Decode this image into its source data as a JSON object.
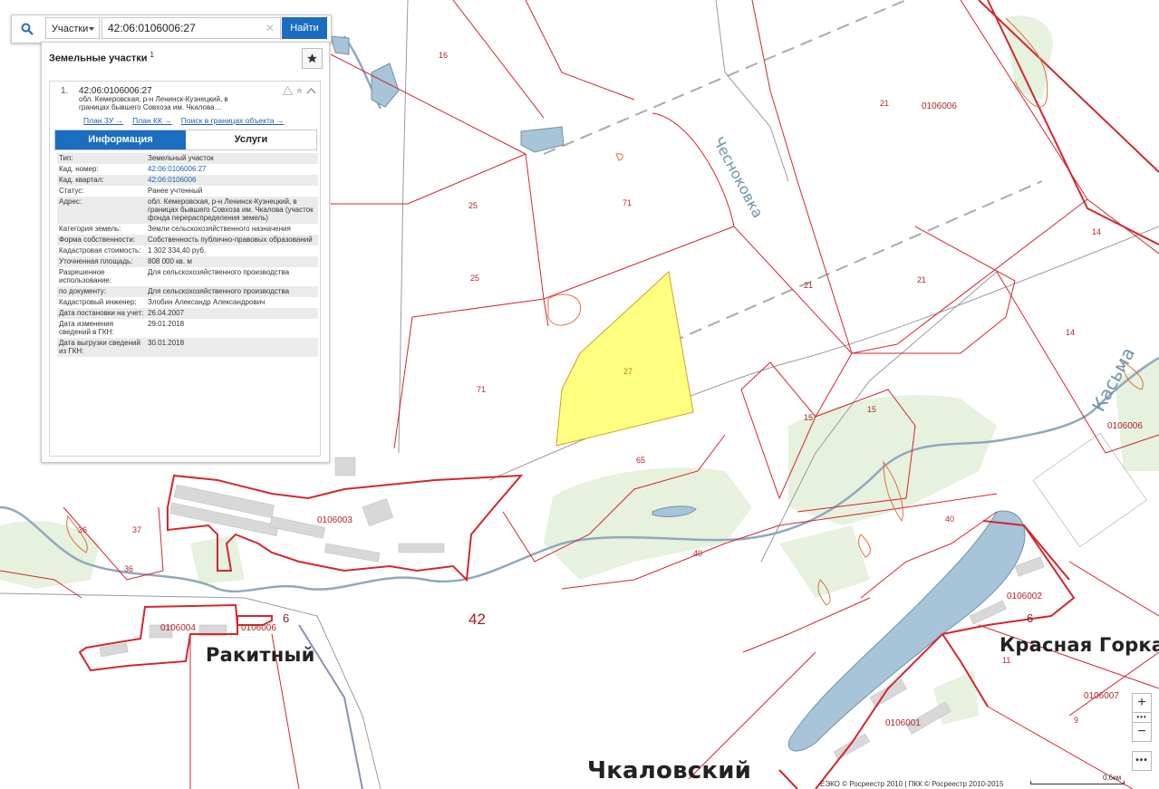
{
  "search": {
    "type_label": "Участки",
    "query": "42:06:0106006:27",
    "button_label": "Найти"
  },
  "panel": {
    "title": "Земельные участки",
    "title_sup": "1",
    "item": {
      "index": "1.",
      "cad_number": "42:06:0106006:27",
      "address_short": "обл. Кемеровская, р-н Ленинск-Кузнецкий, в границах бывшего Совхоза им. Чкалова…",
      "links": [
        "План ЗУ →",
        "План КК →",
        "Поиск в границах объекта →"
      ],
      "tabs": [
        "Информация",
        "Услуги"
      ],
      "rows": [
        {
          "k": "Тип:",
          "v": "Земельный участок"
        },
        {
          "k": "Кад. номер:",
          "v": "42:06:0106006:27",
          "link": true
        },
        {
          "k": "Кад. квартал:",
          "v": "42:06:0106006",
          "link": true
        },
        {
          "k": "Статус:",
          "v": "Ранее учтенный"
        },
        {
          "k": "Адрес:",
          "v": "обл. Кемеровская, р-н Ленинск-Кузнецкий, в границах бывшего Совхоза им. Чкалова (участок фонда перераспределения земель)"
        },
        {
          "k": "Категория земель:",
          "v": "Земли сельскохозяйственного назначения"
        },
        {
          "k": "Форма собственности:",
          "v": "Собственность публично-правовых образований"
        },
        {
          "k": "Кадастровая стоимость:",
          "v": "1 302 334,40 руб."
        },
        {
          "k": "Уточненная площадь:",
          "v": "808 000 кв. м"
        },
        {
          "k": "Разрешенное использование:",
          "v": "Для сельскохозяйственного производства"
        },
        {
          "k": "по документу:",
          "v": "Для сельскохозяйственного производства"
        },
        {
          "k": "Кадастровый инженер:",
          "v": "Злобин Александр Александрович"
        },
        {
          "k": "Дата постановки на учет:",
          "v": "26.04.2007"
        },
        {
          "k": "Дата изменения сведений в ГКН:",
          "v": "29.01.2018"
        },
        {
          "k": "Дата выгрузки сведений из ГКН:",
          "v": "30.01.2018"
        }
      ]
    }
  },
  "map": {
    "towns": [
      "Ракитный",
      "Красная Горка",
      "Чкаловский"
    ],
    "rivers": [
      "Чесноковка",
      "Касьма"
    ],
    "region_number": "42",
    "quarters": [
      "0106006",
      "0106003",
      "0106004",
      "0106006",
      "0106002",
      "0106001",
      "0106007",
      "0106006"
    ],
    "parcels": [
      "16",
      "21",
      "25",
      "71",
      "25",
      "71",
      "27",
      "21",
      "21",
      "14",
      "14",
      "15",
      "15",
      "65",
      "40",
      "40",
      "36",
      "37",
      "36",
      "6",
      "6",
      "11",
      "9"
    ],
    "colors": {
      "boundary": "#d4262e",
      "selected_fill": "#ffff80",
      "water": "#a7c4d8",
      "green": "#e5f1dc"
    }
  },
  "controls": {
    "zoom_in": "+",
    "zoom_out": "−",
    "more": "•••",
    "more2": "•••"
  },
  "footer": {
    "attribution": "ЕЭКО © Росреестр 2010 | ПКК © Росреестр 2010-2015",
    "scale": "0.6км"
  }
}
